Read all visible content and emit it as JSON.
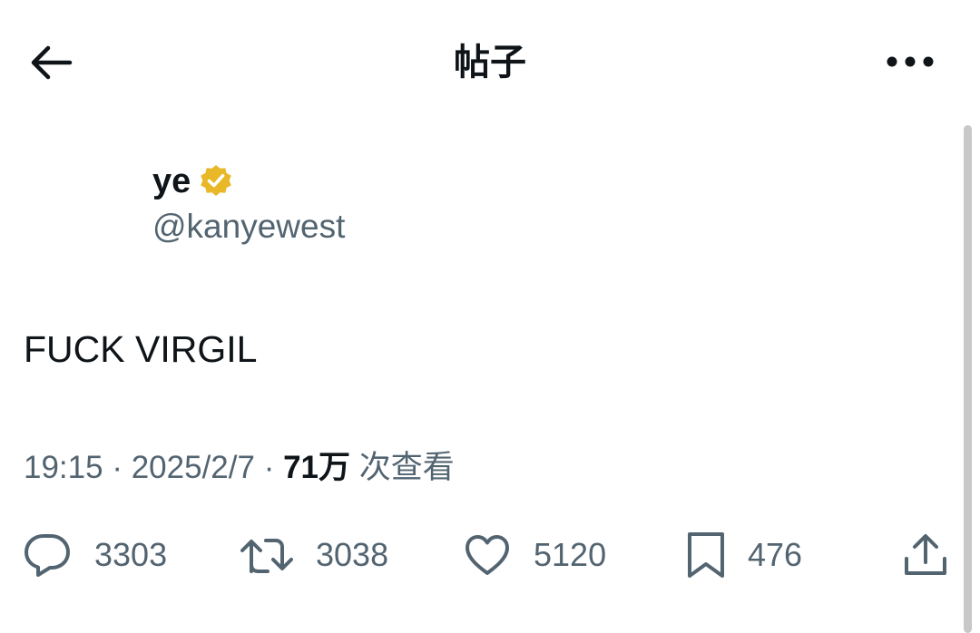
{
  "header": {
    "title": "帖子",
    "back_icon": "arrow-left-icon",
    "more_icon": "more-horizontal-icon"
  },
  "author": {
    "display_name": "ye",
    "handle": "@kanyewest",
    "verified_badge_color": "#e8b829"
  },
  "post": {
    "text": "FUCK VIRGIL"
  },
  "meta": {
    "time": "19:15",
    "separator": "·",
    "date": "2025/2/7",
    "views": "71万",
    "views_label": "次查看"
  },
  "actions": {
    "replies": "3303",
    "reposts": "3038",
    "likes": "5120",
    "bookmarks": "476"
  },
  "colors": {
    "text_primary": "#0f1419",
    "text_secondary": "#536471",
    "scrollbar": "#c8c8c8"
  }
}
